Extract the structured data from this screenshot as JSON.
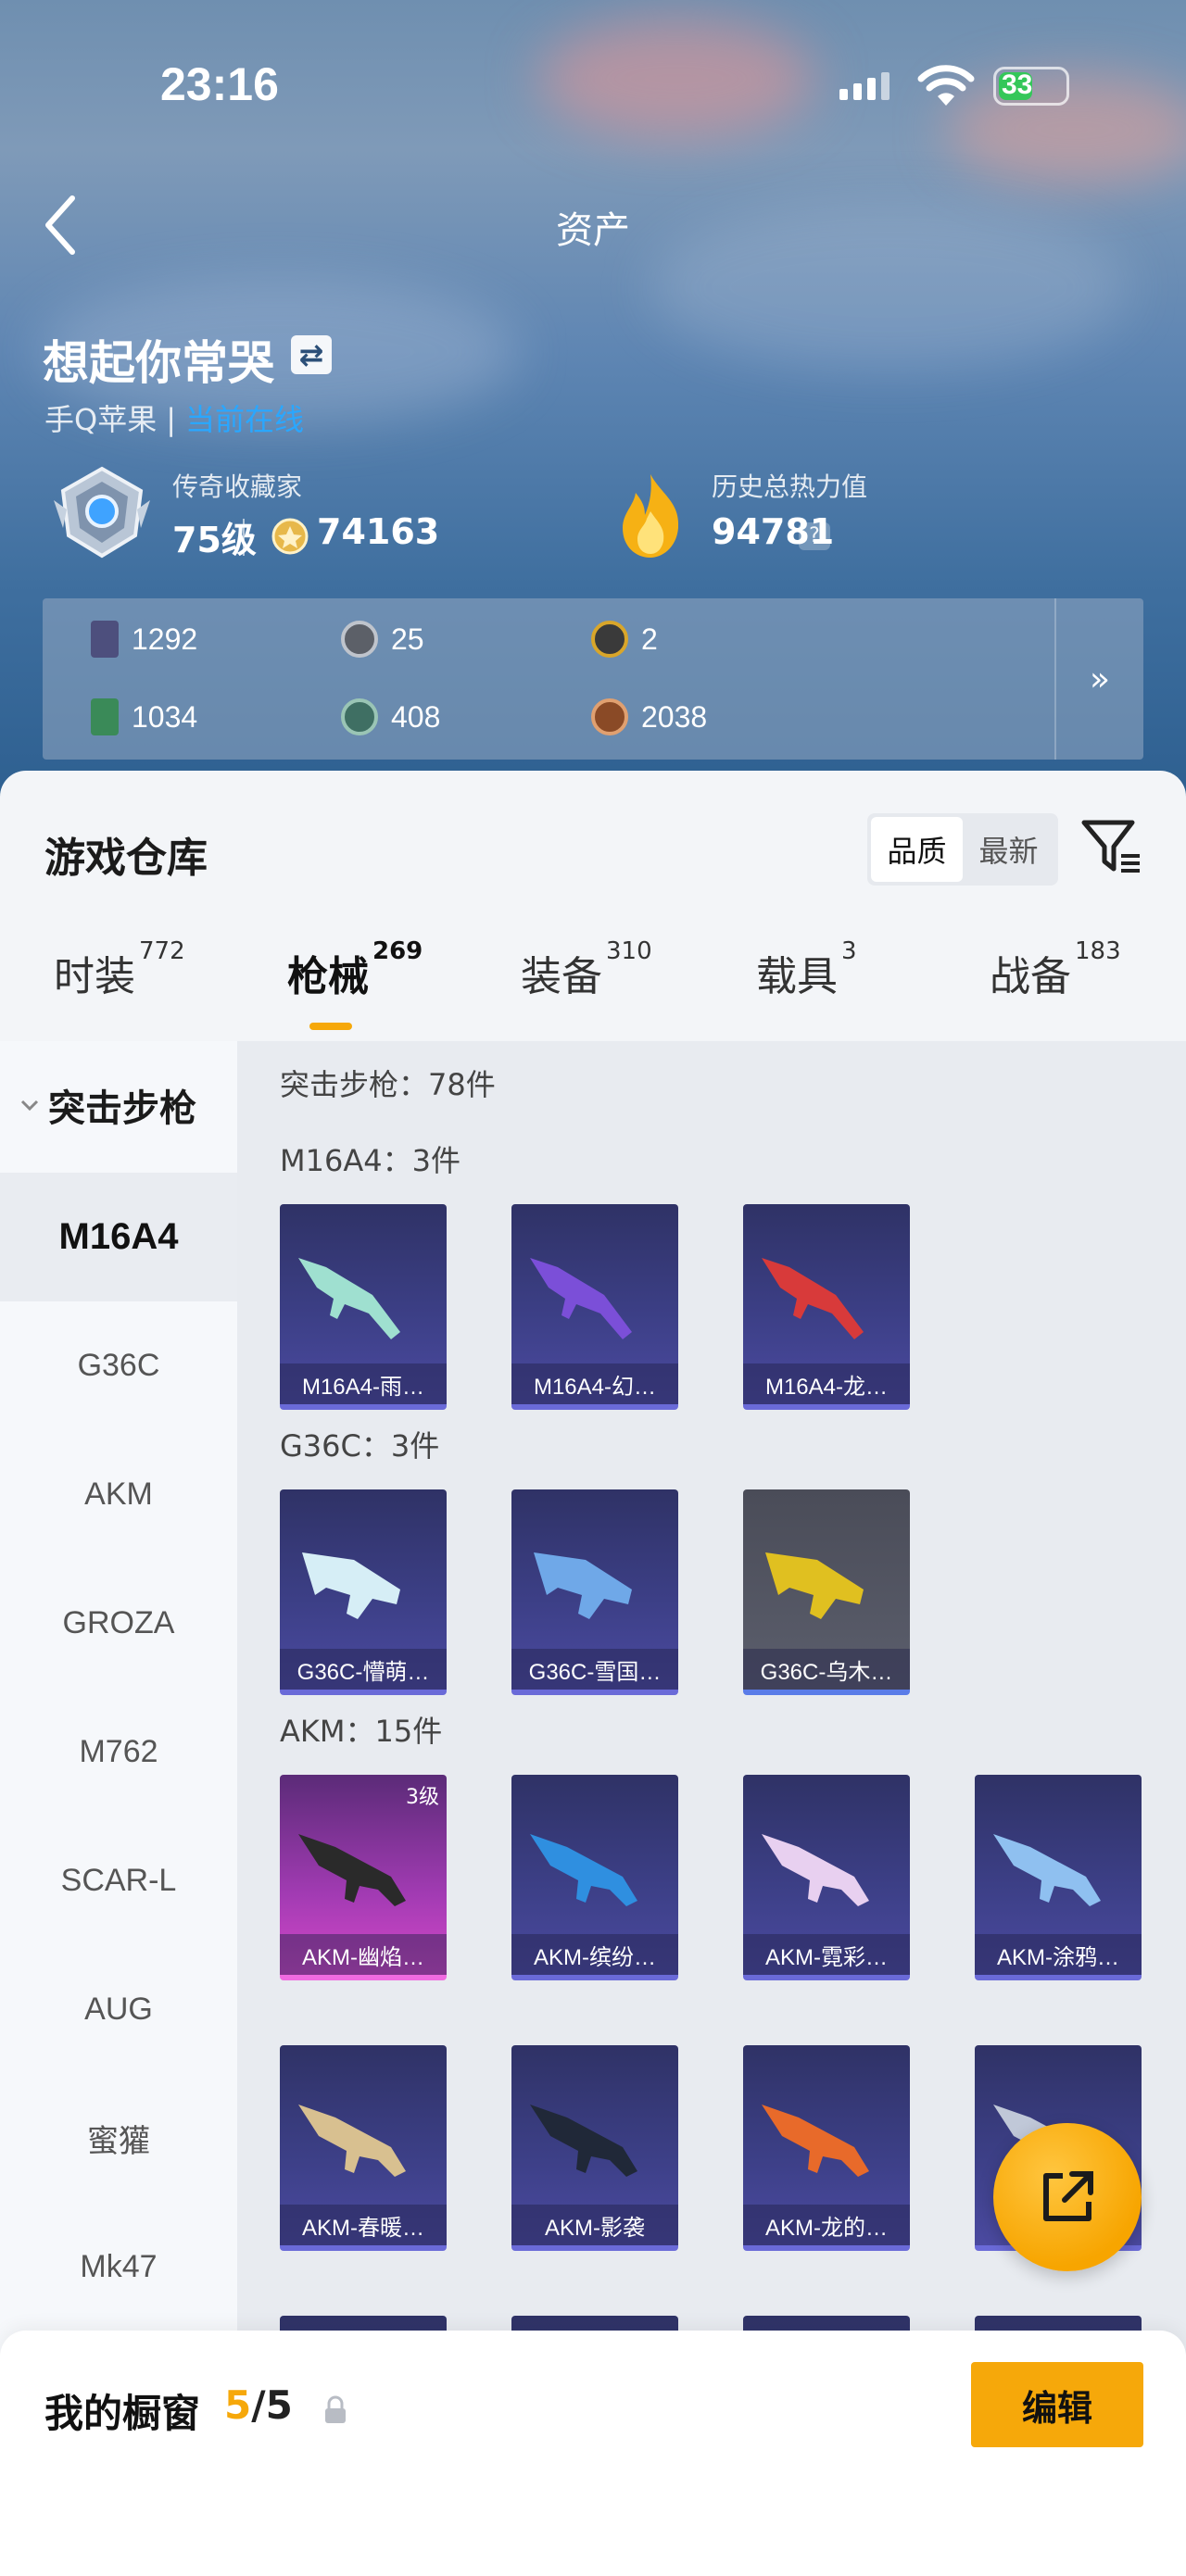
{
  "status_bar": {
    "time": "23:16",
    "battery": "33"
  },
  "nav": {
    "title": "资产"
  },
  "profile": {
    "name": "想起你常哭",
    "platform": "手Q苹果",
    "status": "当前在线",
    "rank_title": "传奇收藏家",
    "level": "75级",
    "coins": "74163",
    "heat_title": "历史总热力值",
    "heat_value": "94781",
    "help": "?"
  },
  "resources": [
    {
      "value": "1292",
      "icon": "card-icon",
      "color": "#5a5d8c"
    },
    {
      "value": "25",
      "icon": "silver-coin-icon",
      "color": "#7a7f88"
    },
    {
      "value": "2",
      "icon": "gold-coin-icon",
      "color": "#c89a2a"
    },
    {
      "value": "1034",
      "icon": "green-card-icon",
      "color": "#3c8c5a"
    },
    {
      "value": "408",
      "icon": "green-coin-icon",
      "color": "#4f7f70"
    },
    {
      "value": "2038",
      "icon": "bronze-coin-icon",
      "color": "#b0683a"
    }
  ],
  "resources_more": "»",
  "warehouse": {
    "title": "游戏仓库",
    "sort": [
      "品质",
      "最新"
    ],
    "tabs": [
      {
        "label": "时装",
        "count": "772"
      },
      {
        "label": "枪械",
        "count": "269"
      },
      {
        "label": "装备",
        "count": "310"
      },
      {
        "label": "载具",
        "count": "3"
      },
      {
        "label": "战备",
        "count": "183"
      }
    ]
  },
  "sidebar": {
    "group": "突击步枪",
    "items": [
      "M16A4",
      "G36C",
      "AKM",
      "GROZA",
      "M762",
      "SCAR-L",
      "AUG",
      "蜜獾",
      "Mk47"
    ]
  },
  "content": {
    "total": "突击步枪：78件",
    "groups": [
      {
        "title": "M16A4：3件",
        "items": [
          "M16A4-雨…",
          "M16A4-幻…",
          "M16A4-龙…"
        ]
      },
      {
        "title": "G36C：3件",
        "items": [
          "G36C-懵萌…",
          "G36C-雪国…",
          "G36C-乌木…"
        ]
      },
      {
        "title": "AKM：15件",
        "items": [
          "AKM-幽焰…",
          "AKM-缤纷…",
          "AKM-霓彩…",
          "AKM-涂鸦…",
          "AKM-春暖…",
          "AKM-影袭",
          "AKM-龙的…"
        ]
      }
    ],
    "akm_level_badge": "3级"
  },
  "showcase": {
    "title": "我的橱窗",
    "current": "5",
    "total": "/5",
    "edit": "编辑"
  },
  "colors": {
    "accent": "#f6a80a",
    "online": "#2aa7ff"
  }
}
